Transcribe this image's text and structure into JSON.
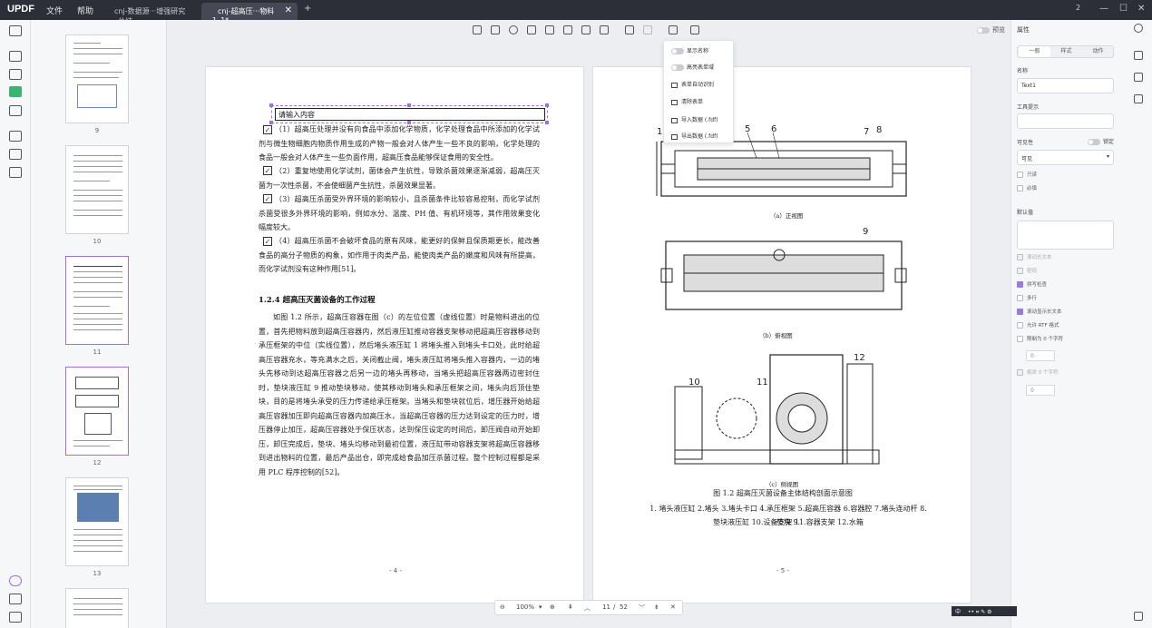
{
  "titlebar": {
    "logo": "UPDF",
    "menu_file": "文件",
    "menu_help": "帮助",
    "tab1": "cnj-数据源···增强研究_总结",
    "tab2": "cnj-超高压···物料_1_1*",
    "tab_new": "+",
    "count": "2",
    "win_min": "—",
    "win_max": "☐",
    "win_close": "✕"
  },
  "thumbnails": [
    {
      "label": "9"
    },
    {
      "label": "10"
    },
    {
      "label": "11"
    },
    {
      "label": "12"
    },
    {
      "label": "13"
    }
  ],
  "toolbar": {
    "preview_label": "预览"
  },
  "dropdown": {
    "items": [
      "显示名称",
      "高亮表单域",
      "表单自动识别",
      "清除表单",
      "导入数据 (.fdf)",
      "导出数据 (.fdf)"
    ]
  },
  "page_left": {
    "textfield_placeholder": "请输入内容",
    "para1": "（1）超高压处理并没有向食品中添加化学物质，化学处理食品中所添加的化学试剂与微生物细胞内物质作用生成的产物一般会对人体产生一些不良的影响，化学处理的食品一般会对人体产生一些负面作用，超高压食品能够保证食用的安全性。",
    "para2": "（2）重复地使用化学试剂，菌体会产生抗性，导致杀菌效果逐渐减弱，超高压灭菌为一次性杀菌，不会使细菌产生抗性，杀菌效果显著。",
    "para3": "（3）超高压杀菌受外界环境的影响较小，且杀菌条件比较容易控制，而化学试剂杀菌受很多外界环境的影响，例如水分、温度、PH 值、有机环境等，其作用效果变化幅度较大。",
    "para4": "（4）超高压杀菌不会破坏食品的原有风味，能更好的保鲜且保质期更长，能改善食品的高分子物质的构象，如作用于肉类产品，能使肉类产品的嫩度和风味有所提高，而化学试剂没有这种作用[51]。",
    "heading": "1.2.4 超高压灭菌设备的工作过程",
    "body": "如图 1.2 所示，超高压容器在图（c）的左位位置（虚线位置）时是物料进出的位置，首先把物料放到超高压容器内，然后液压缸推动容器支架移动把超高压容器移动到承压框架的中位（实线位置），然后堵头液压缸 1 将堵头推入到堵头卡口处，此时给超高压容器充水，等充满水之后，关闭截止阀，堵头液压缸将堵头推入容器内，一边的堵头先移动到达超高压容器之后另一边的堵头再移动，当堵头把超高压容器两边密封住时，垫块液压缸 9 推动垫块移动，使其移动到堵头和承压框架之间，堵头向后顶住垫块，目的是将堵头承受的压力传递给承压框架。当堵头和垫块就位后，增压器开始给超高压容器加压即向超高压容器内加高压水，当超高压容器的压力达到设定的压力时，增压器停止加压，超高压容器处于保压状态，达到保压设定的时间后，卸压阀自动开始卸压，卸压完成后，垫块、堵头均移动到最初位置，液压缸带动容器支架将超高压容器移到进出物料的位置，最后产品出仓，即完成给食品加压杀菌过程。整个控制过程都是采用 PLC 程序控制的[52]。",
    "page_number": "- 4 -"
  },
  "page_right": {
    "caption_a": "（a）正视图",
    "caption_b": "（b）俯视图",
    "caption_c": "（c）侧视图",
    "fig_title": "图 1.2 超高压灭菌设备主体结构剖面示意图",
    "legend_line1": "1. 堵头液压缸 2.堵头 3.堵头卡口 4.承压框架 5.超高压容器 6.容器腔 7.堵头连动杆 8.垫块 9.",
    "legend_line2": "垫块液压缸 10.设备支架 11.容器支架 12.水箱",
    "labels": [
      "1",
      "5",
      "6",
      "7",
      "8",
      "9",
      "10",
      "11",
      "12"
    ],
    "page_number": "- 5 -"
  },
  "right_panel": {
    "title": "属性",
    "seg_general": "一般",
    "seg_style": "样式",
    "seg_action": "动作",
    "name_label": "名称",
    "name_value": "Text1",
    "tooltip_label": "工具提示",
    "visibility_label": "可见性",
    "visibility_toggle": "锁定",
    "visibility_value": "可见",
    "check_readonly": "只读",
    "check_required": "必填",
    "default_label": "默认值",
    "opt1": "滚动长文本",
    "opt2": "密码",
    "opt3": "拼写检查",
    "opt4": "多行",
    "opt5": "滚动显示长文本",
    "opt6": "允许 RTF 格式",
    "opt7": "限制为 0 个字符",
    "opt8": "梳状 0 个字符",
    "stepper1": "0",
    "stepper2": "0"
  },
  "zoombar": {
    "zoom": "100%",
    "page_current": "11",
    "page_total": "52"
  },
  "status": {
    "lang": "中"
  }
}
